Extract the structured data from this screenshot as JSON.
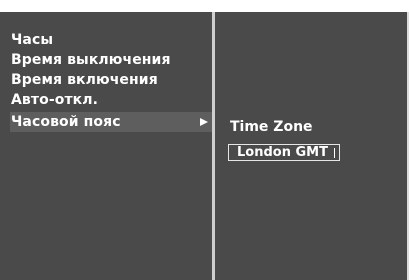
{
  "menu": {
    "items": [
      {
        "label": "Часы",
        "selected": false
      },
      {
        "label": "Время выключения",
        "selected": false
      },
      {
        "label": "Время включения",
        "selected": false
      },
      {
        "label": "Авто-откл.",
        "selected": false
      },
      {
        "label": "Часовой пояс",
        "selected": true
      }
    ],
    "selected_indicator_icon": "right-triangle-arrow-icon"
  },
  "submenu": {
    "title": "Time Zone",
    "value": "London GMT"
  },
  "colors": {
    "background": "#4a4a4a",
    "highlight": "#5e5e5e",
    "text": "#ffffff",
    "divider": "#cfcfcf"
  }
}
